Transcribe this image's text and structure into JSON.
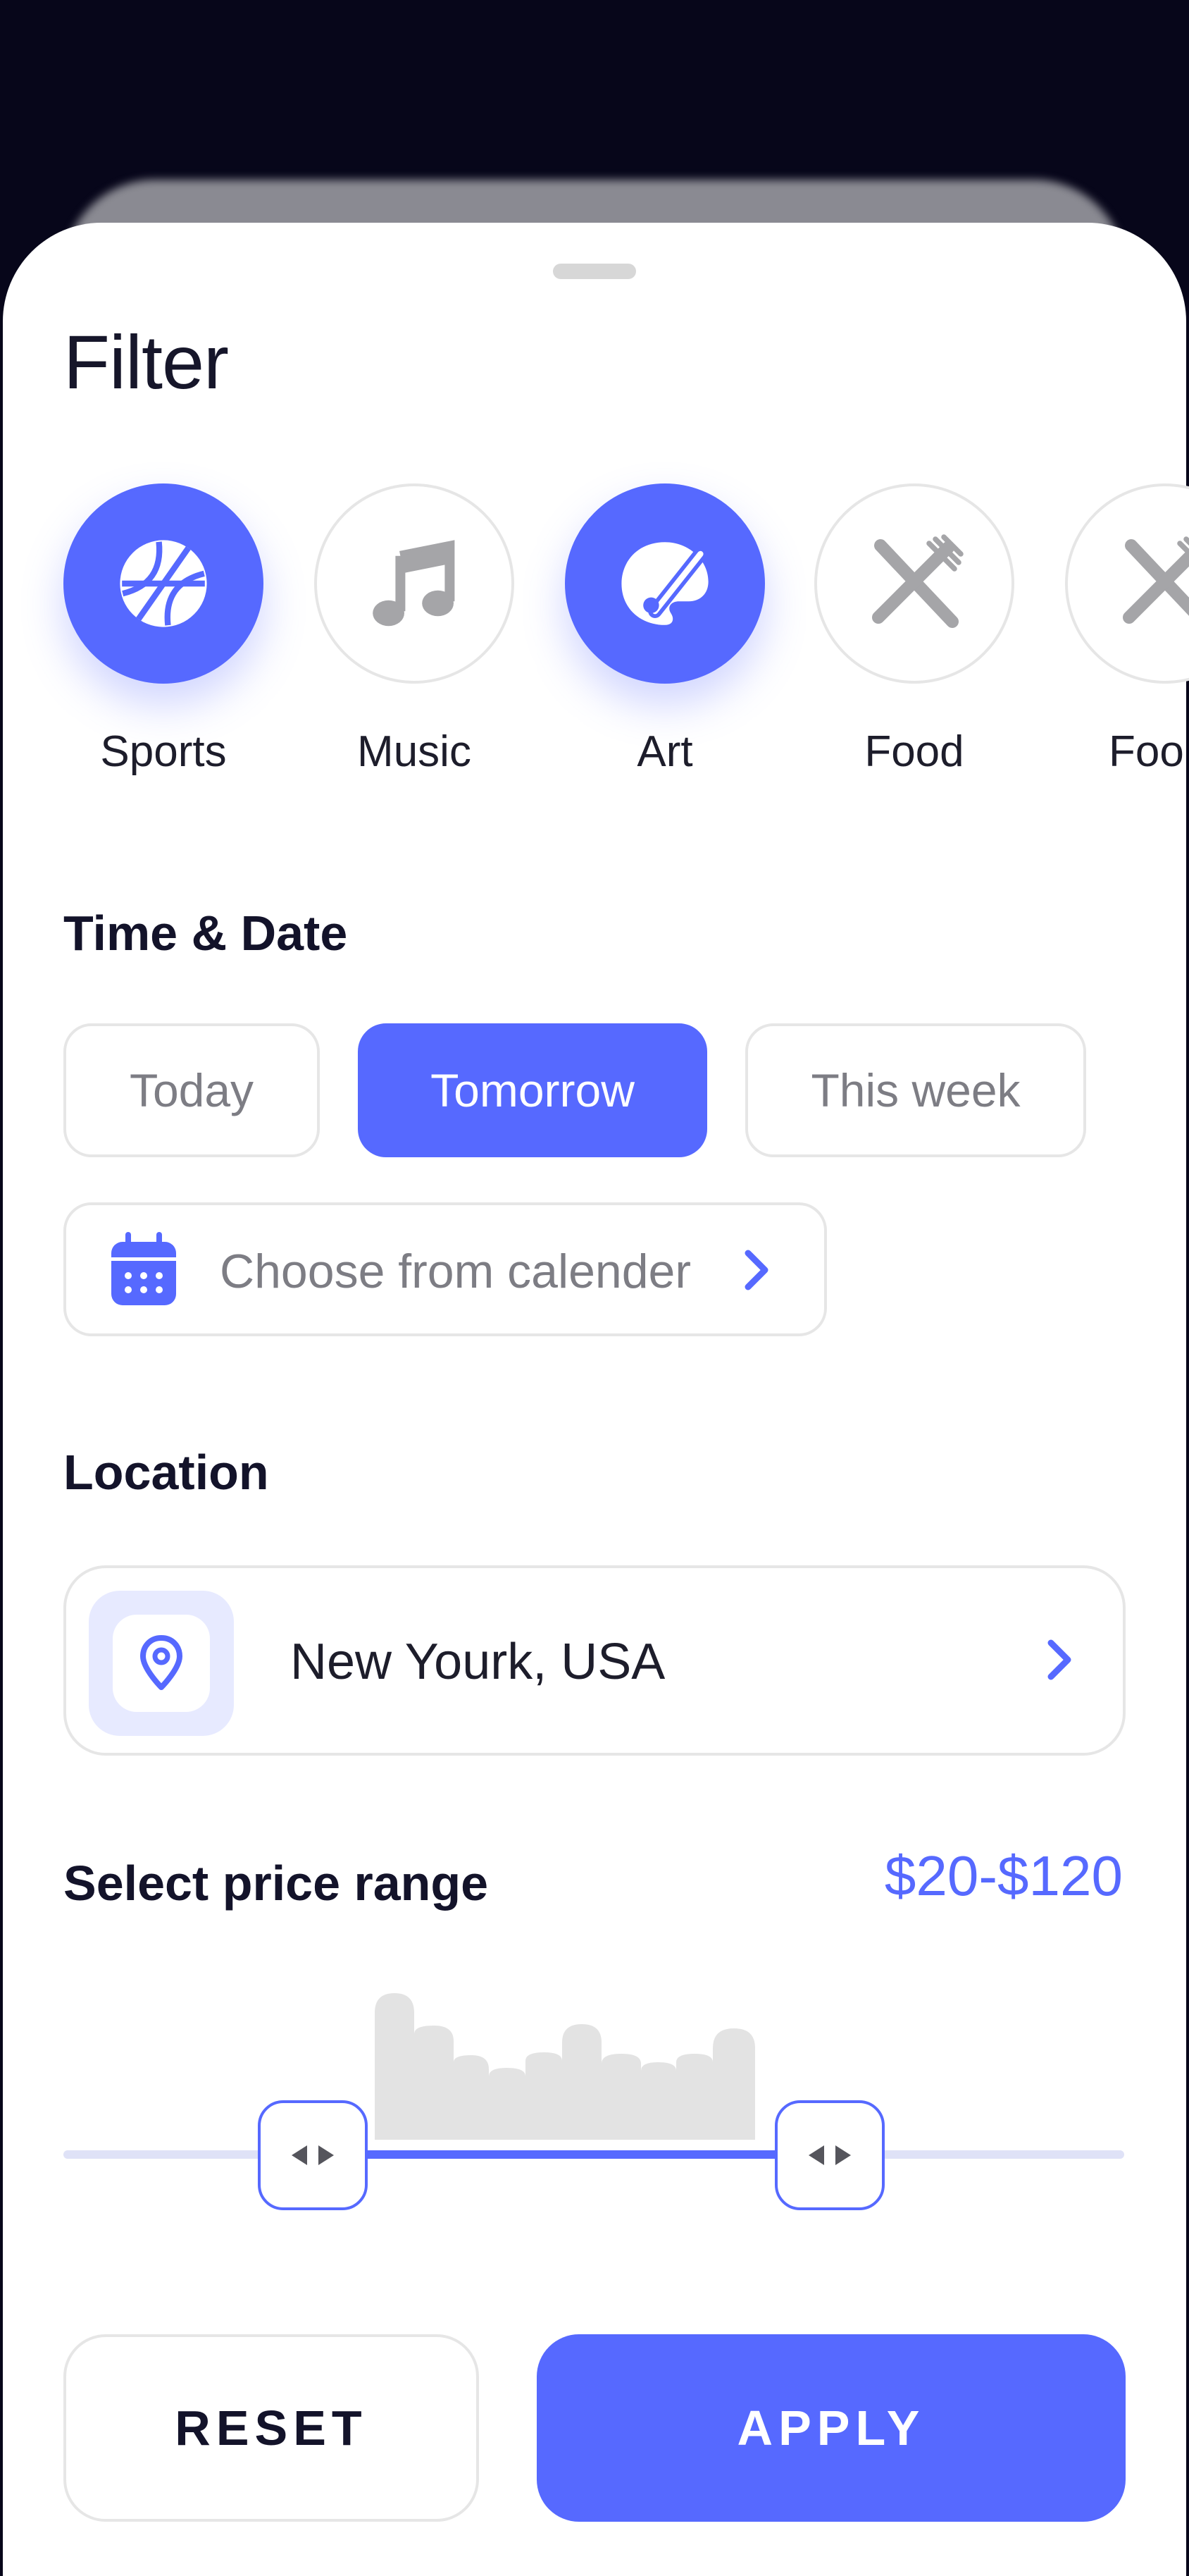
{
  "title": "Filter",
  "categories": [
    {
      "label": "Sports",
      "icon": "basketball-icon",
      "active": true
    },
    {
      "label": "Music",
      "icon": "music-note-icon",
      "active": false
    },
    {
      "label": "Art",
      "icon": "palette-icon",
      "active": true
    },
    {
      "label": "Food",
      "icon": "fork-knife-icon",
      "active": false
    },
    {
      "label": "Foo",
      "icon": "fork-knife-icon",
      "active": false
    }
  ],
  "time_date": {
    "title": "Time & Date",
    "options": [
      "Today",
      "Tomorrow",
      "This week"
    ],
    "selected": "Tomorrow",
    "calendar_label": "Choose from calender"
  },
  "location": {
    "title": "Location",
    "value": "New Yourk, USA"
  },
  "price": {
    "title": "Select price range",
    "range_text": "$20-$120"
  },
  "buttons": {
    "reset": "RESET",
    "apply": "APPLY"
  },
  "colors": {
    "accent": "#5669ff",
    "background_dark": "#07061a",
    "muted_text": "#7d7d84",
    "border": "#e6e6e6"
  }
}
